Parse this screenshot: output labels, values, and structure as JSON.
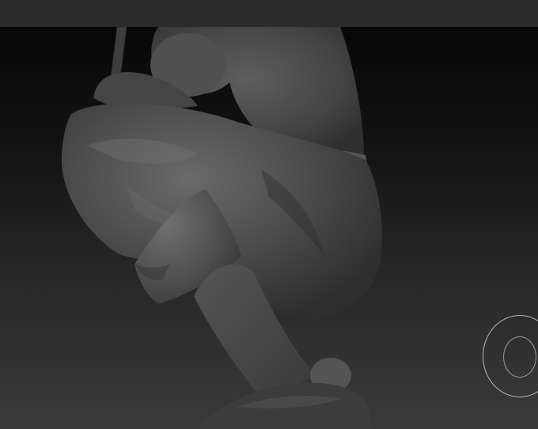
{
  "app": {
    "colors": {
      "top_bar": "#2b2b2b",
      "viewport_top": "#070707",
      "viewport_bottom": "#3a3a3a",
      "model_base": "#4a4a4a",
      "model_highlight": "#6a6a6a",
      "gizmo_ring": "#b8b8b8"
    }
  },
  "viewport": {
    "model": "sculpted-legs-and-pants-mesh",
    "gizmo": "navigation-rotate-icon"
  }
}
